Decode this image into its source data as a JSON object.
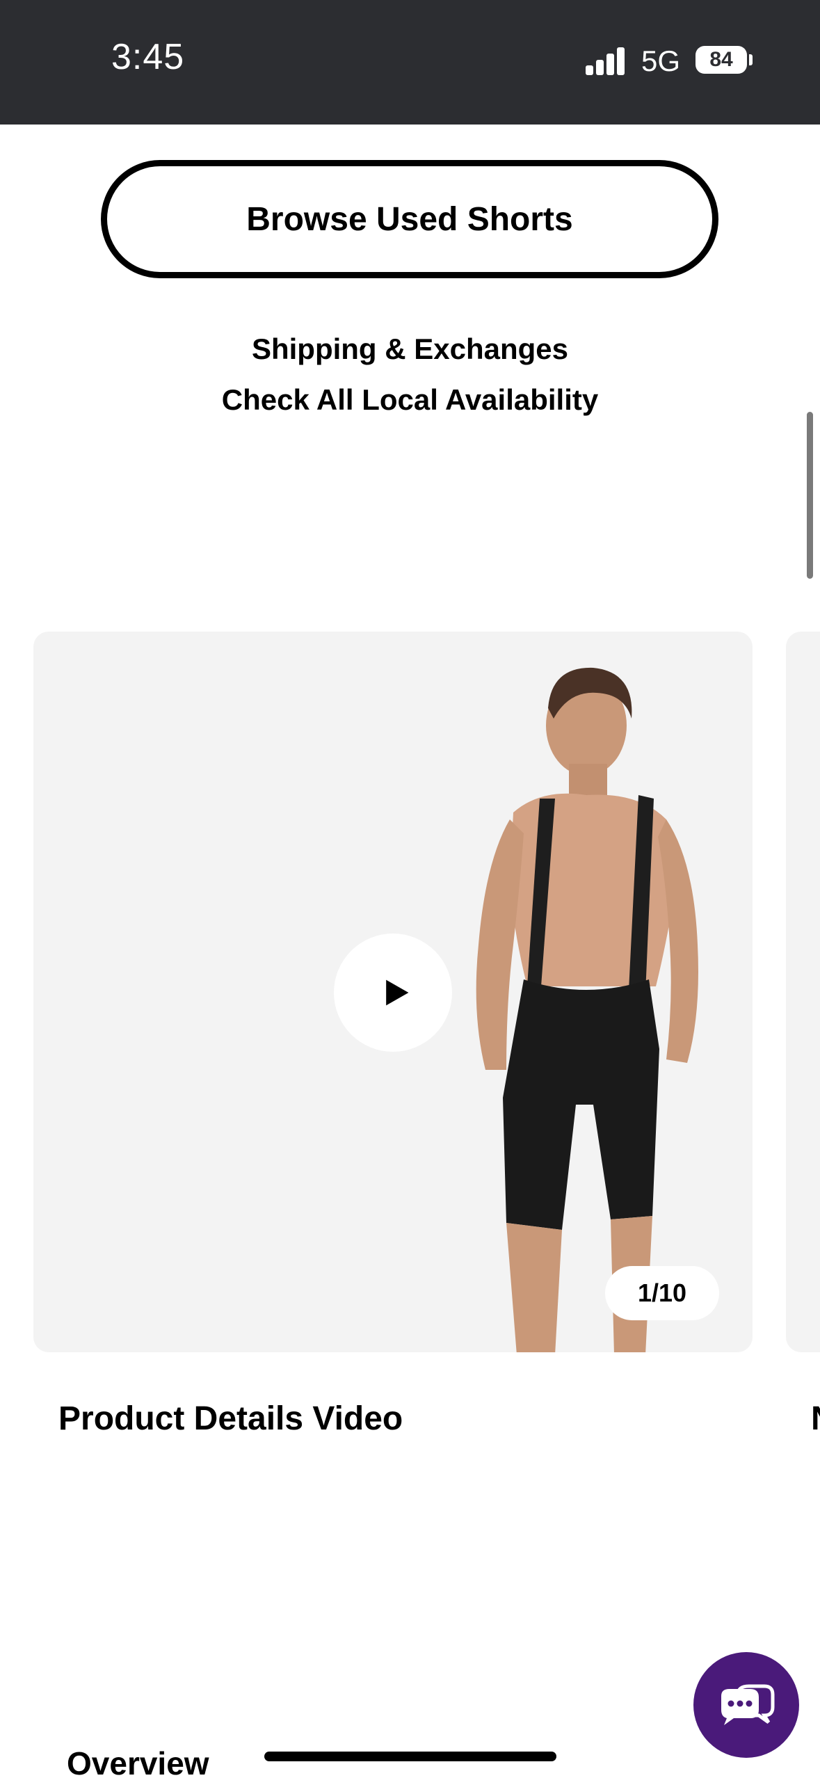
{
  "status_bar": {
    "time": "3:45",
    "network": "5G",
    "battery": "84"
  },
  "actions": {
    "browse_label": "Browse Used Shorts",
    "shipping_label": "Shipping & Exchanges",
    "availability_label": "Check All Local Availability"
  },
  "media": {
    "counter": "1/10",
    "title": "Product Details Video",
    "next_title_fragment": "N"
  },
  "sections": {
    "overview_label": "Overview"
  },
  "colors": {
    "status_bar_bg": "#2c2d31",
    "chat_button": "#4a1a7a",
    "media_bg": "#f3f3f3"
  },
  "icons": {
    "play": "play-icon",
    "chat": "chat-bubbles-icon",
    "signal": "signal-icon"
  }
}
